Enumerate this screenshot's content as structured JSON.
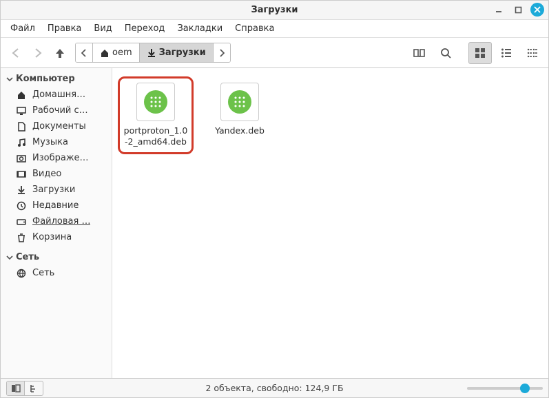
{
  "window": {
    "title": "Загрузки"
  },
  "menu": {
    "file": "Файл",
    "edit": "Правка",
    "view": "Вид",
    "go": "Переход",
    "bookmarks": "Закладки",
    "help": "Справка"
  },
  "path": {
    "home": "oem",
    "current": "Загрузки"
  },
  "sidebar": {
    "section_computer": "Компьютер",
    "section_network": "Сеть",
    "items": [
      {
        "label": "Домашня…",
        "icon": "home"
      },
      {
        "label": "Рабочий с…",
        "icon": "desktop"
      },
      {
        "label": "Документы",
        "icon": "documents"
      },
      {
        "label": "Музыка",
        "icon": "music"
      },
      {
        "label": "Изображе…",
        "icon": "pictures"
      },
      {
        "label": "Видео",
        "icon": "video"
      },
      {
        "label": "Загрузки",
        "icon": "downloads"
      },
      {
        "label": "Недавние",
        "icon": "recent"
      },
      {
        "label": "Файловая …",
        "icon": "filesystem",
        "underline": true
      },
      {
        "label": "Корзина",
        "icon": "trash"
      }
    ],
    "network_item": "Сеть"
  },
  "files": [
    {
      "name": "portproton_1.0-2_amd64.deb",
      "highlighted": true
    },
    {
      "name": "Yandex.deb",
      "highlighted": false
    }
  ],
  "statusbar": {
    "text": "2 объекта, свободно: 124,9 ГБ"
  }
}
